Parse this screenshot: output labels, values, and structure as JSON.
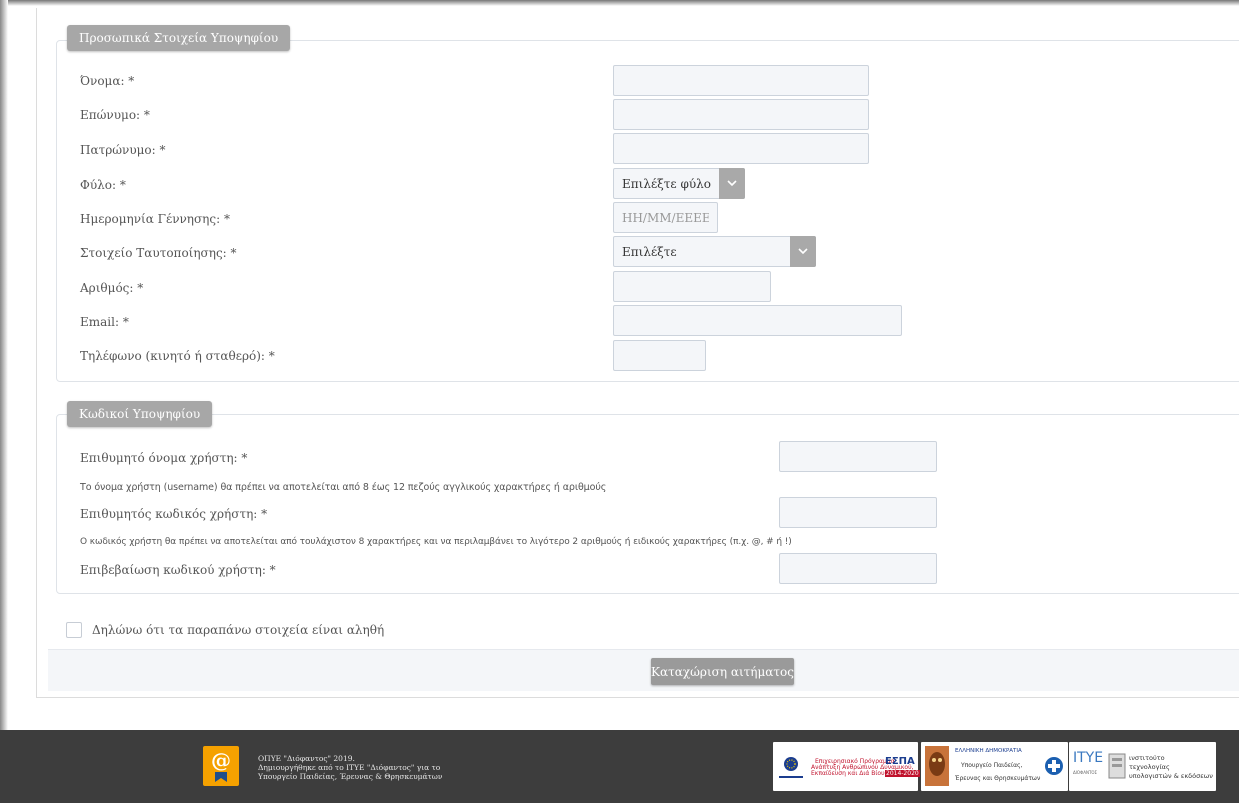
{
  "personal": {
    "legend": "Προσωπικά Στοιχεία Υποψηφίου",
    "first_name_label": "Όνομα: *",
    "last_name_label": "Επώνυμο: *",
    "father_name_label": "Πατρώνυμο: *",
    "gender_label": "Φύλο: *",
    "gender_value": "Επιλέξτε φύλο",
    "dob_label": "Ημερομηνία Γέννησης: *",
    "dob_placeholder": "HH/MM/EEEE",
    "id_type_label": "Στοιχείο Ταυτοποίησης: *",
    "id_type_value": "Επιλέξτε",
    "id_number_label": "Αριθμός: *",
    "email_label": "Email: *",
    "phone_label": "Τηλέφωνο (κινητό ή σταθερό): *"
  },
  "credentials": {
    "legend": "Κωδικοί Υποψηφίου",
    "username_label": "Επιθυμητό όνομα χρήστη: *",
    "username_help": "Το όνομα χρήστη (username) θα πρέπει να αποτελείται από 8 έως 12 πεζούς αγγλικούς χαρακτήρες ή αριθμούς",
    "password_label": "Επιθυμητός κωδικός χρήστη: *",
    "password_help": "Ο κωδικός χρήστη θα πρέπει να αποτελείται από τουλάχιστον 8 χαρακτήρες και να περιλαμβάνει το λιγότερο 2 αριθμούς ή ειδικούς χαρακτήρες (π.χ. @, # ή !)",
    "confirm_label": "Επιβεβαίωση κωδικού χρήστη: *"
  },
  "declaration_label": "Δηλώνω ότι τα παραπάνω στοιχεία είναι αληθή",
  "submit_label": "Καταχώριση αιτήματος",
  "footer": {
    "line1": "ΟΠΥΕ \"Διόφαντος\" 2019.",
    "line2": "Δημιουργήθηκε από το ΙΤΥΕ \"Διόφαντος\" για το",
    "line3": "Υπουργείο Παιδείας, Έρευνας & Θρησκευμάτων",
    "espa_text1": "Επιχειρησιακό Πρόγραμμα",
    "espa_text2": "Ανάπτυξη Ανθρώπινου Δυναμικού,",
    "espa_text3": "Εκπαίδευση και Διά Βίου Μάθηση",
    "espa_logo": "ΕΣΠΑ",
    "espa_years": "2014-2020",
    "gov1": "ΕΛΛΗΝΙΚΗ ΔΗΜΟΚΡΑΤΙΑ",
    "gov2": "Υπουργείο Παιδείας,",
    "gov3": "Έρευνας και Θρησκευμάτων",
    "itye1": "ινστιτούτο",
    "itye2": "τεχνολογίας",
    "itye3": "υπολογιστών & εκδόσεων",
    "itye_logo": "ΙΤΥΕ",
    "itye_sub": "ΔΙΟΦΑΝΤΟΣ"
  },
  "colors": {
    "legend_bg": "#a7a7a7",
    "footer_bg": "#3d3d3d",
    "footer_logo": "#f5a100",
    "input_bg": "#f4f6f9"
  }
}
